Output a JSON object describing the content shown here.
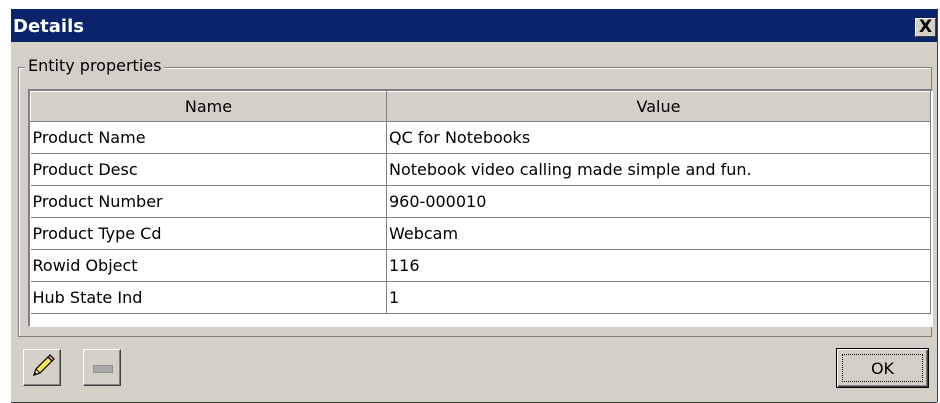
{
  "window": {
    "title": "Details",
    "close_label": "X"
  },
  "group": {
    "legend": "Entity properties"
  },
  "table": {
    "headers": {
      "name": "Name",
      "value": "Value"
    },
    "rows": [
      {
        "name": "Product Name",
        "value": "QC for Notebooks"
      },
      {
        "name": "Product Desc",
        "value": "Notebook video calling made simple and fun."
      },
      {
        "name": "Product Number",
        "value": "960-000010"
      },
      {
        "name": "Product Type Cd",
        "value": "Webcam"
      },
      {
        "name": "Rowid Object",
        "value": "116"
      },
      {
        "name": "Hub State Ind",
        "value": "1"
      }
    ]
  },
  "buttons": {
    "ok_label": "OK",
    "edit_icon": "pencil-icon",
    "remove_icon": "minus-icon"
  }
}
